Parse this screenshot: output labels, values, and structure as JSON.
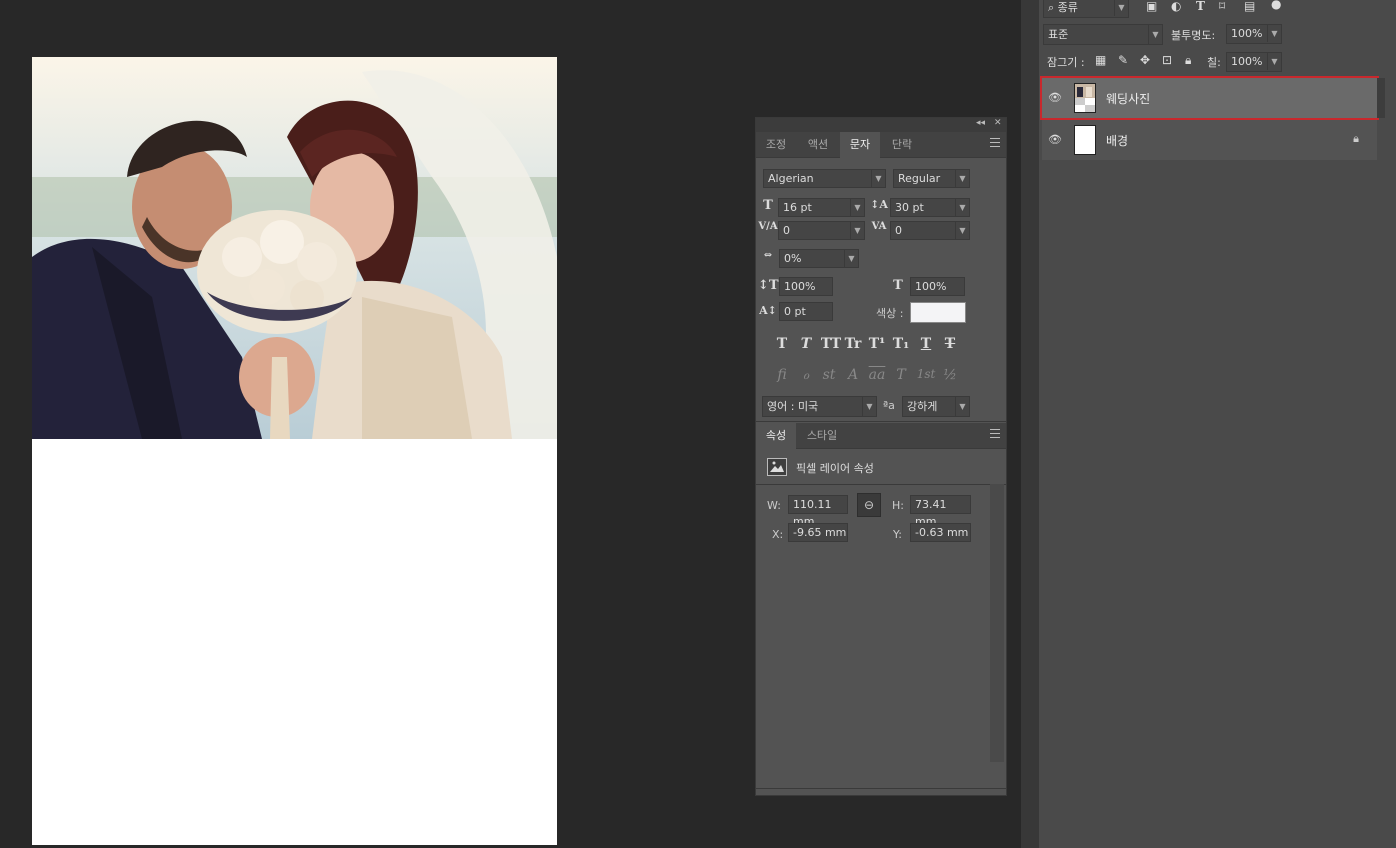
{
  "canvas": {
    "photo_description_none": ""
  },
  "character_panel": {
    "tabs": [
      "조정",
      "액션",
      "문자",
      "단락"
    ],
    "active_tab": "문자",
    "font_family": "Algerian",
    "font_style": "Regular",
    "font_size": "16 pt",
    "leading": "30 pt",
    "kerning": "0",
    "tracking": "0",
    "tsume": "0%",
    "vertical_scale": "100%",
    "horizontal_scale": "100%",
    "baseline_shift": "0 pt",
    "color_label": "색상 :",
    "color_value": "#f4f4f6",
    "language": "영어 : 미국",
    "antialias_label": "ªa",
    "antialias": "강하게",
    "style_glyphs": [
      "T",
      "T",
      "TT",
      "Tr",
      "T¹",
      "T₁",
      "T",
      "T"
    ],
    "opentype_glyphs": [
      "ﬁ",
      "ℴ",
      "st",
      "A",
      "aa",
      "T",
      "1st",
      "½"
    ]
  },
  "properties_panel": {
    "tabs": [
      "속성",
      "스타일"
    ],
    "active_tab": "속성",
    "title": "픽셀 레이어 속성",
    "w_label": "W:",
    "w_value": "110.11 mm",
    "h_label": "H:",
    "h_value": "73.41 mm",
    "x_label": "X:",
    "x_value": "-9.65 mm",
    "y_label": "Y:",
    "y_value": "-0.63 mm"
  },
  "layers_panel": {
    "filter_label": "종류",
    "blend_mode": "표준",
    "opacity_label": "불투명도:",
    "opacity": "100%",
    "lock_label": "잠그기 :",
    "fill_label": "칠:",
    "fill": "100%",
    "layers": [
      {
        "name": "웨딩사진",
        "selected": true
      },
      {
        "name": "배경",
        "locked": true
      }
    ]
  },
  "colors": {
    "selection_outline": "#c9282d",
    "panel": "#535353",
    "workspace": "#282828"
  }
}
